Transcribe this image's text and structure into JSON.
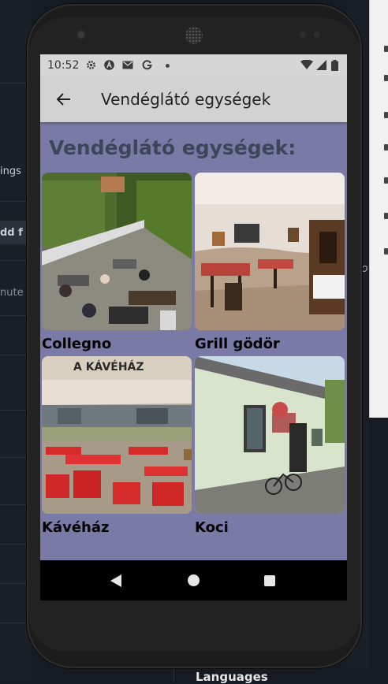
{
  "ide": {
    "left_texts": [
      "ings",
      "dd f",
      "nute"
    ],
    "bottom_label": "Languages",
    "right_glyph": "o"
  },
  "status": {
    "time": "10:52",
    "icons": [
      "gear-icon",
      "a-circle-icon",
      "mail-icon",
      "g-icon",
      "dot-icon",
      "wifi-icon",
      "signal-icon",
      "battery-icon"
    ]
  },
  "app_bar": {
    "title": "Vendéglátó egységek"
  },
  "page": {
    "heading": "Vendéglátó egységek:"
  },
  "places": [
    {
      "name": "Collegno"
    },
    {
      "name": "Grill gödör"
    },
    {
      "name": "Kávéház",
      "sign_text": "A KÁVÉHÁZ"
    },
    {
      "name": "Koci"
    }
  ],
  "colors": {
    "screen_bg": "#7a7aa6",
    "app_bar_bg": "#d2d2d2",
    "heading_color": "#3d4659"
  }
}
